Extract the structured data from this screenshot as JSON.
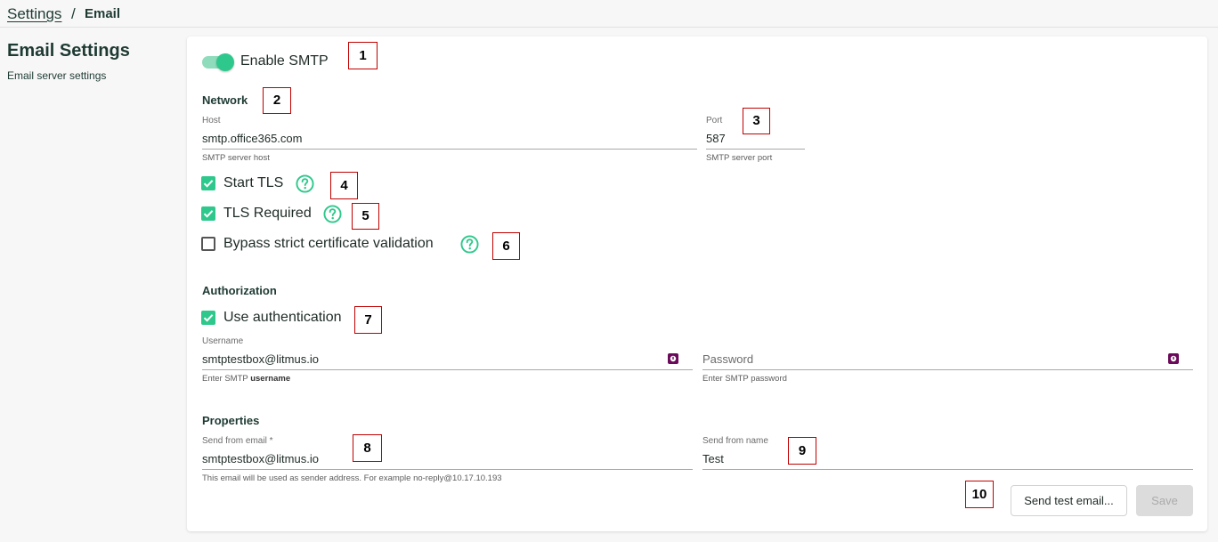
{
  "breadcrumb": {
    "parent": "Settings",
    "separator": "/",
    "current": "Email"
  },
  "page": {
    "title": "Email Settings",
    "subtitle": "Email server settings"
  },
  "smtp_toggle": {
    "label": "Enable SMTP",
    "on": true
  },
  "network": {
    "title": "Network",
    "host": {
      "label": "Host",
      "value": "smtp.office365.com",
      "helper": "SMTP server host"
    },
    "port": {
      "label": "Port",
      "value": "587",
      "helper": "SMTP server port"
    },
    "start_tls": {
      "label": "Start TLS",
      "checked": true
    },
    "tls_required": {
      "label": "TLS Required",
      "checked": true
    },
    "bypass_cert": {
      "label": "Bypass strict certificate validation",
      "checked": false
    }
  },
  "authorization": {
    "title": "Authorization",
    "use_auth": {
      "label": "Use authentication",
      "checked": true
    },
    "username": {
      "label": "Username",
      "value": "smtptestbox@litmus.io",
      "helper_prefix": "Enter SMTP",
      "helper_bold": "username"
    },
    "password": {
      "placeholder": "Password",
      "helper": "Enter SMTP password"
    }
  },
  "properties": {
    "title": "Properties",
    "send_from_email": {
      "label": "Send from email *",
      "value": "smtptestbox@litmus.io",
      "helper": "This email will be used as sender address. For example no-reply@10.17.10.193"
    },
    "send_from_name": {
      "label": "Send from name",
      "value": "Test"
    }
  },
  "actions": {
    "send_test": "Send test email...",
    "save": "Save"
  },
  "markers": [
    "1",
    "2",
    "3",
    "4",
    "5",
    "6",
    "7",
    "8",
    "9",
    "10"
  ],
  "colors": {
    "accent": "#2fc88c",
    "accent_light": "#8fdcbc",
    "text": "#1e3a33",
    "badge": "#6b0a5a",
    "marker_border": "#c00000"
  }
}
